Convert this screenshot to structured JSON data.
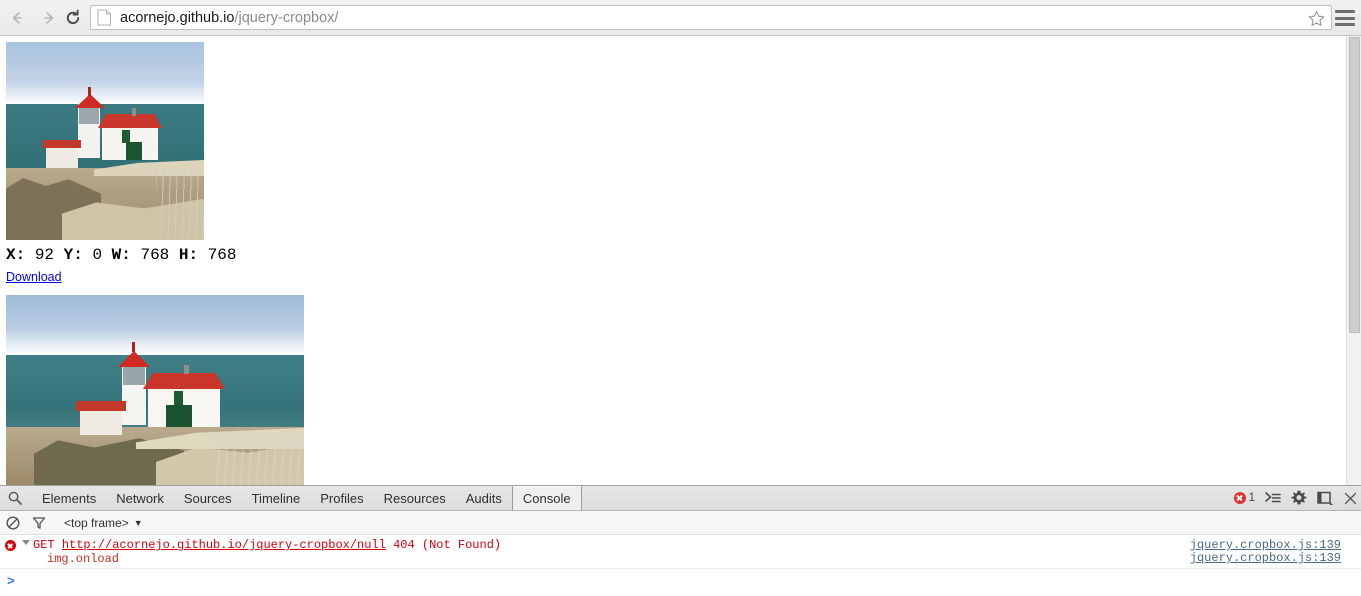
{
  "browser": {
    "back_icon": "back-arrow-icon",
    "forward_icon": "forward-arrow-icon",
    "reload_icon": "reload-icon",
    "page_icon": "page-document-icon",
    "url_host": "acornejo.github.io",
    "url_path": "/jquery-cropbox/",
    "url_full": "acornejo.github.io/jquery-cropbox/",
    "star_icon": "bookmark-star-icon",
    "menu_icon": "hamburger-menu-icon"
  },
  "page": {
    "thumb_alt": "cropped-lighthouse-preview",
    "wide_alt": "lighthouse-crop-source",
    "coords": {
      "x_label": "X:",
      "x_value": "92",
      "y_label": "Y:",
      "y_value": "0",
      "w_label": "W:",
      "w_value": "768",
      "h_label": "H:",
      "h_value": "768",
      "full_text": "X: 92 Y: 0 W: 768 H: 768"
    },
    "download_label": "Download"
  },
  "devtools": {
    "search_icon": "search-icon",
    "tabs": [
      {
        "label": "Elements",
        "selected": false
      },
      {
        "label": "Network",
        "selected": false
      },
      {
        "label": "Sources",
        "selected": false
      },
      {
        "label": "Timeline",
        "selected": false
      },
      {
        "label": "Profiles",
        "selected": false
      },
      {
        "label": "Resources",
        "selected": false
      },
      {
        "label": "Audits",
        "selected": false
      },
      {
        "label": "Console",
        "selected": true
      }
    ],
    "error_count": "1",
    "error_badge_color": "#e03131",
    "toolbar_icons": {
      "console_drawer": "console-drawer-icon",
      "settings": "gear-icon",
      "dock": "dock-window-icon",
      "close": "close-icon"
    },
    "filterbar": {
      "clear_icon": "clear-console-icon",
      "filter_icon": "filter-funnel-icon",
      "frame_label": "<top frame>",
      "frame_caret": "chevron-down-icon"
    },
    "console": {
      "error_icon": "error-circle-icon",
      "expand_icon": "collapse-triangle-icon",
      "method": "GET",
      "url": "http://acornejo.github.io/jquery-cropbox/null",
      "status": "404 (Not Found)",
      "stack_line": "img.onload",
      "source_link_1": "jquery.cropbox.js:139",
      "source_link_2": "jquery.cropbox.js:139",
      "error_color": "#d8000c",
      "link_color": "#4a6b8a",
      "prompt": ">"
    }
  }
}
